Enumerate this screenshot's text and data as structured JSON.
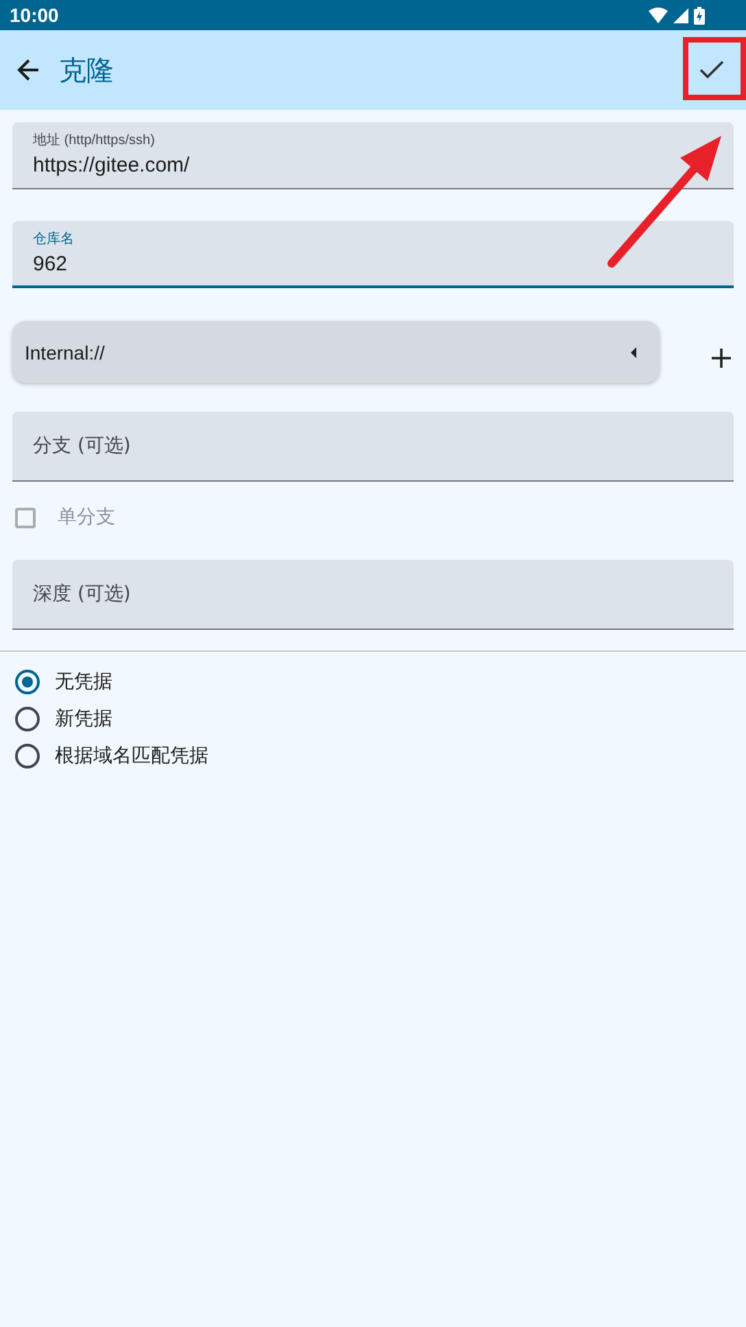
{
  "status_bar": {
    "time": "10:00"
  },
  "app_bar": {
    "title": "克隆"
  },
  "fields_top": [
    {
      "label": "地址 (http/https/ssh)",
      "value": "https://gitee.com/",
      "focused": false
    },
    {
      "label": "仓库名",
      "value": "962",
      "focused": true
    }
  ],
  "storage": {
    "value": "Internal://"
  },
  "branch_field": {
    "label": "分支 (可选)",
    "focused": false
  },
  "single_branch": {
    "label": "单分支",
    "checked": false,
    "disabled": true
  },
  "depth_field": {
    "label": "深度 (可选)",
    "focused": false
  },
  "credentials": [
    {
      "label": "无凭据",
      "selected": true
    },
    {
      "label": "新凭据",
      "selected": false
    },
    {
      "label": "根据域名匹配凭据",
      "selected": false
    }
  ]
}
